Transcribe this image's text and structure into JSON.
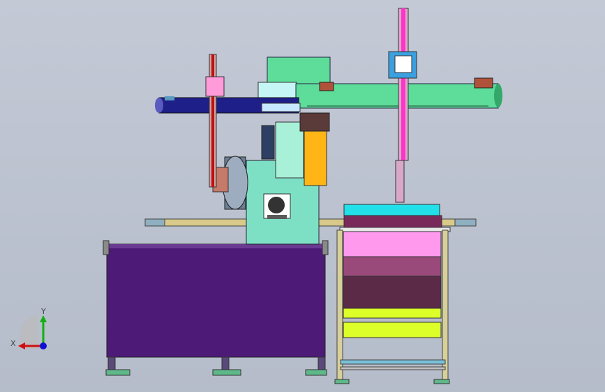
{
  "viewport": {
    "background_top": "#c3c9d5",
    "background_bottom": "#b5bcca"
  },
  "colors": {
    "cabinet_purple": "#4e1a78",
    "machine_teal": "#7de0c5",
    "gantry_green": "#5edc9a",
    "gantry_blue": "#1f1f8a",
    "bin_pink": "#ff99ee",
    "bin_mauve": "#9a4a7a",
    "bin_dark": "#5a2a46",
    "bin_lime": "#dcff2a",
    "cyan_bar": "#22e0ea",
    "orange_block": "#ffb515",
    "magenta_column": "#ff33cc",
    "frame_tan": "#d8d09a"
  },
  "triad": {
    "x_label": "X",
    "y_label": "Y",
    "x_color": "#d01010",
    "y_color": "#10b010",
    "z_color": "#1010d0"
  }
}
